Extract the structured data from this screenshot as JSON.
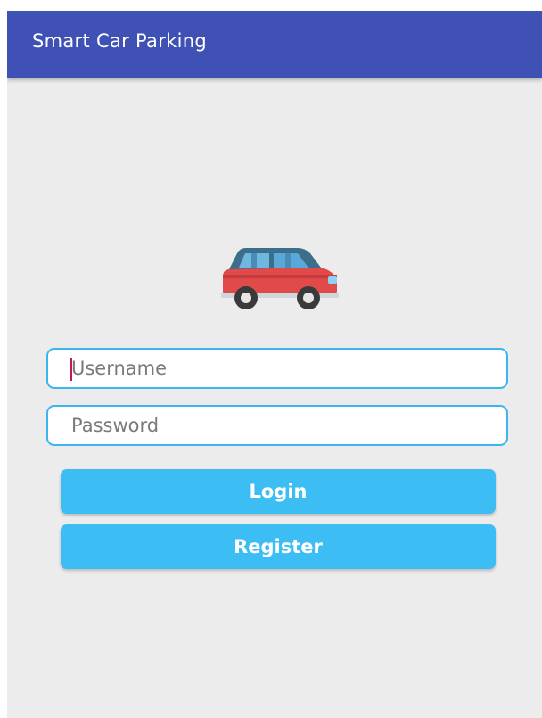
{
  "app_bar": {
    "title": "Smart Car Parking",
    "color": "#3f51b5"
  },
  "logo": {
    "icon": "car-icon"
  },
  "form": {
    "username_placeholder": "Username",
    "password_placeholder": "Password",
    "field_border_color": "#3ab5f0"
  },
  "buttons": {
    "login_label": "Login",
    "register_label": "Register",
    "color": "#3cbdf4"
  }
}
